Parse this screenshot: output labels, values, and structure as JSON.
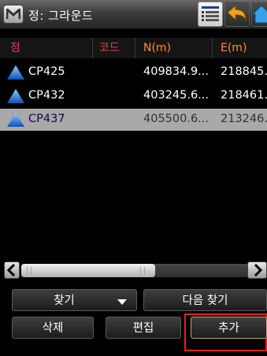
{
  "window": {
    "title": "정: 그라운드"
  },
  "toolbar": {
    "list_icon": "list-view-icon",
    "back_icon": "back-arrow-icon",
    "home_icon": "home-icon"
  },
  "table": {
    "columns": [
      "점",
      "코드",
      "N(m)",
      "E(m)"
    ],
    "rows": [
      {
        "point": "CP425",
        "code": "",
        "n": "409834.9...",
        "e": "218845.",
        "selected": false
      },
      {
        "point": "CP432",
        "code": "",
        "n": "403245.6...",
        "e": "218461.",
        "selected": false
      },
      {
        "point": "CP437",
        "code": "",
        "n": "405500.6...",
        "e": "213246.",
        "selected": true
      }
    ]
  },
  "scrollbar": {
    "position": 0.0
  },
  "buttons": {
    "find": "찾기",
    "find_next": "다음 찾기",
    "delete": "삭제",
    "edit": "편집",
    "add": "추가"
  },
  "colors": {
    "header_text": "#e0404a",
    "header_value_text": "#ff8a40",
    "selection": "#a9a9a9",
    "highlight_frame": "#e21f1f",
    "point_icon": "#1e6fd6"
  }
}
